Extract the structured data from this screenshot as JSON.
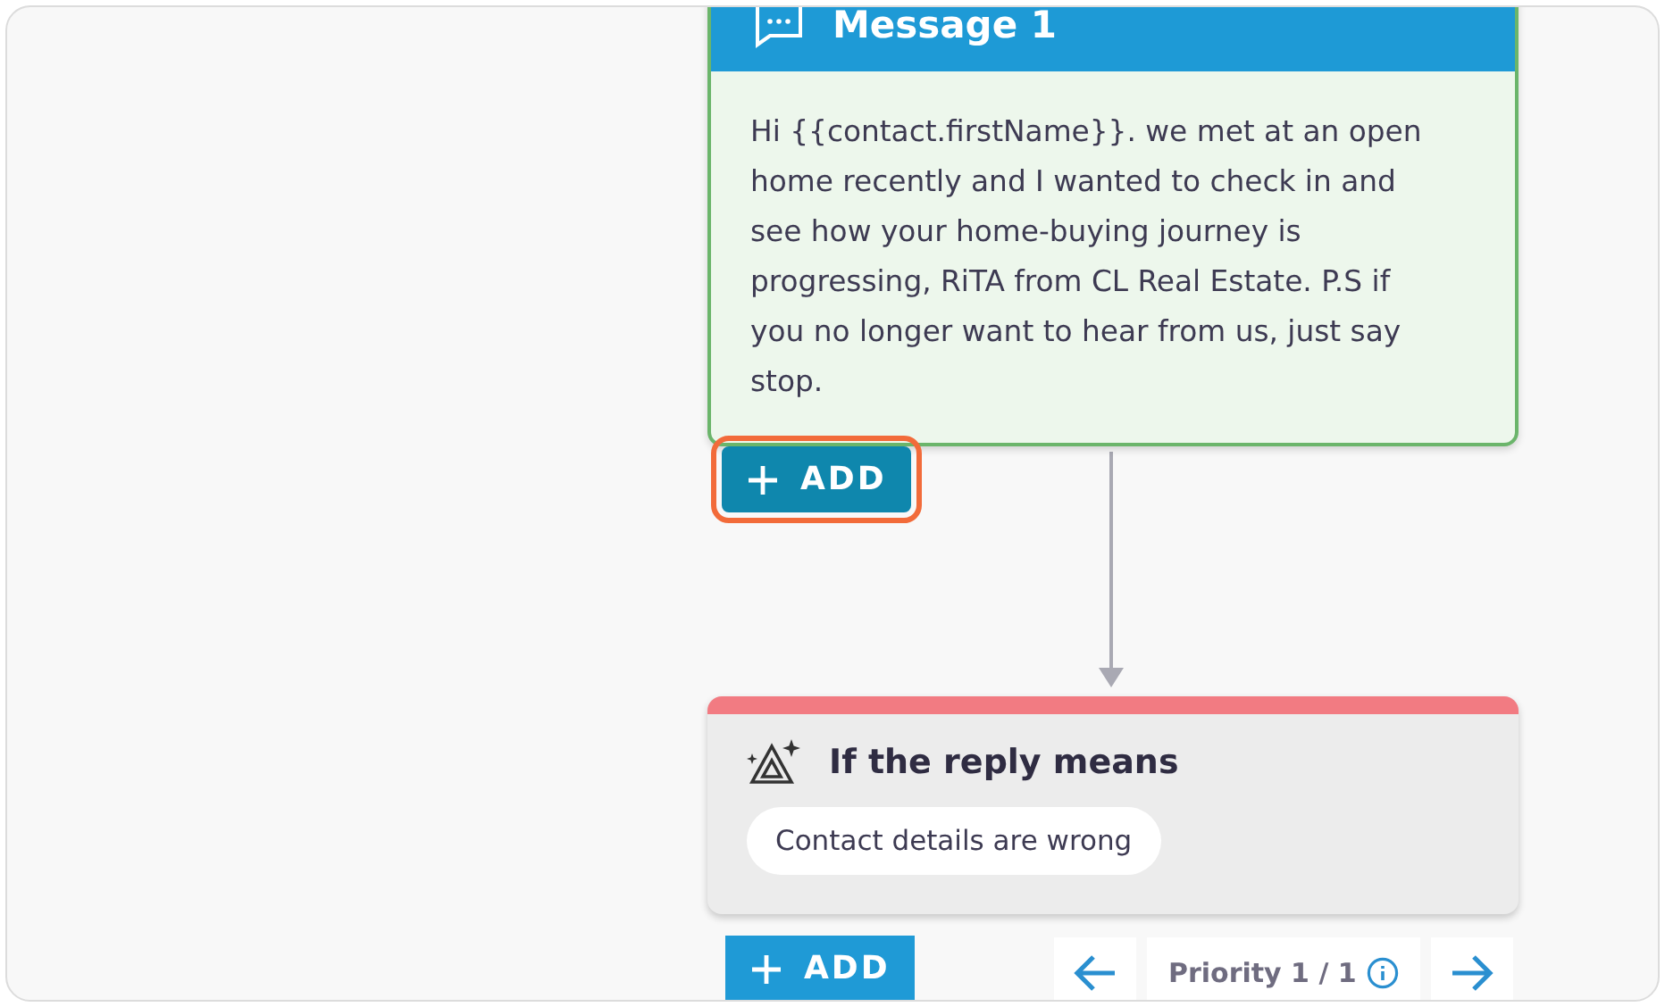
{
  "message": {
    "title": "Message 1",
    "body": "Hi {{contact.firstName}}. we met at an open home recently and I wanted to check in and see how your home-buying journey is progressing, RiTA from CL Real Estate. P.S if you no longer want to hear from us, just say stop.",
    "add_button": {
      "label": "ADD",
      "focused": true
    }
  },
  "condition": {
    "title": "If the reply means",
    "intent": "Contact details are wrong",
    "add_button": {
      "label": "ADD",
      "focused": false
    }
  },
  "priority": {
    "label": "Priority 1 / 1"
  }
}
